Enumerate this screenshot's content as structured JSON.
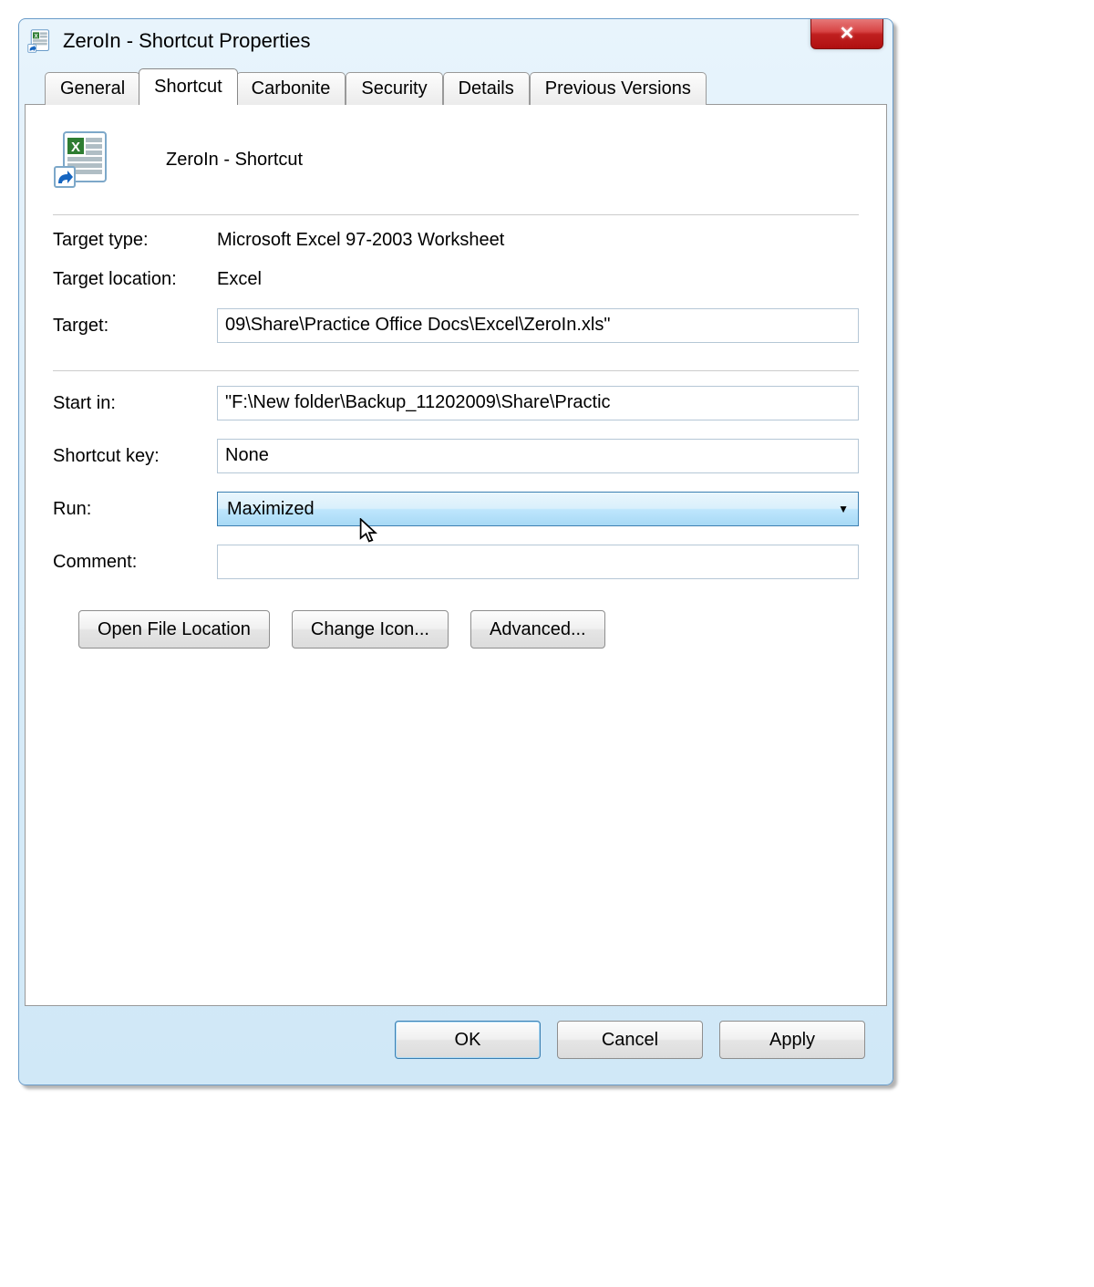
{
  "window": {
    "title": "ZeroIn - Shortcut Properties"
  },
  "tabs": [
    {
      "label": "General"
    },
    {
      "label": "Shortcut"
    },
    {
      "label": "Carbonite"
    },
    {
      "label": "Security"
    },
    {
      "label": "Details"
    },
    {
      "label": "Previous Versions"
    }
  ],
  "active_tab_index": 1,
  "shortcut": {
    "name": "ZeroIn - Shortcut",
    "target_type_label": "Target type:",
    "target_type": "Microsoft Excel 97-2003 Worksheet",
    "target_location_label": "Target location:",
    "target_location": "Excel",
    "target_label": "Target:",
    "target": "09\\Share\\Practice Office Docs\\Excel\\ZeroIn.xls\"",
    "start_in_label": "Start in:",
    "start_in": "\"F:\\New folder\\Backup_11202009\\Share\\Practic",
    "shortcut_key_label": "Shortcut key:",
    "shortcut_key": "None",
    "run_label": "Run:",
    "run_selected": "Maximized",
    "comment_label": "Comment:",
    "comment": ""
  },
  "buttons": {
    "open_file_location": "Open File Location",
    "change_icon": "Change Icon...",
    "advanced": "Advanced...",
    "ok": "OK",
    "cancel": "Cancel",
    "apply": "Apply"
  }
}
